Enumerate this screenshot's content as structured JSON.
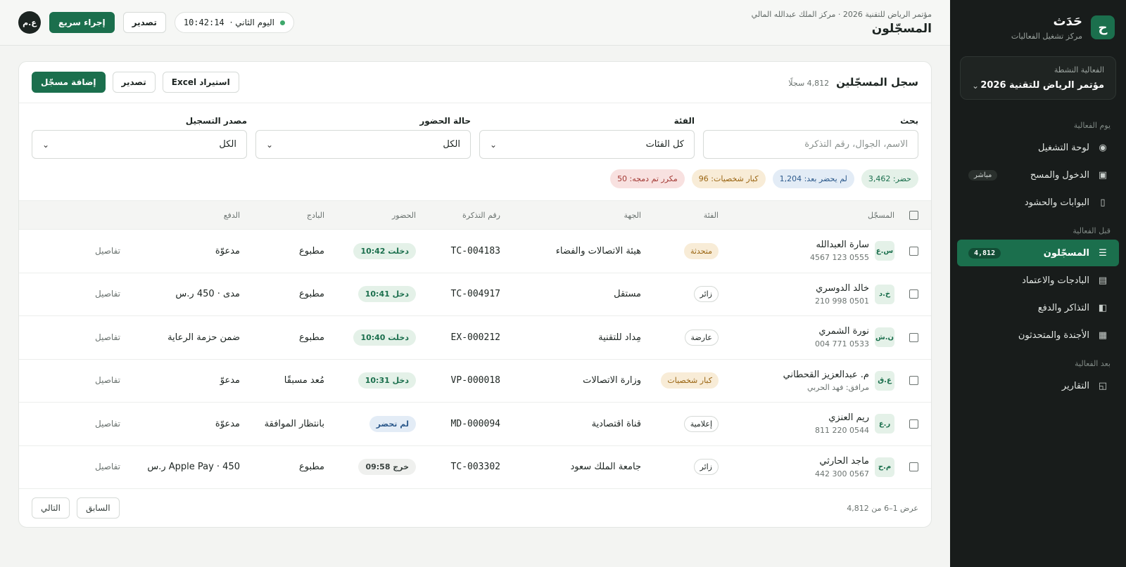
{
  "brand": {
    "logo": "ح",
    "name": "حَدَث",
    "subtitle": "مركز تشغيل الفعاليات"
  },
  "event": {
    "label": "الفعالية النشطة",
    "value": "مؤتمر الرياض للتقنية 2026"
  },
  "sidebar": {
    "sections": [
      {
        "label": "يوم الفعالية",
        "items": [
          {
            "label": "لوحة التشغيل",
            "icon": "target-icon",
            "glyph": "◉",
            "badge": ""
          },
          {
            "label": "الدخول والمسح",
            "icon": "scanner-icon",
            "glyph": "▣",
            "badge": "مباشر"
          },
          {
            "label": "البوابات والحشود",
            "icon": "gate-icon",
            "glyph": "▯",
            "badge": ""
          }
        ]
      },
      {
        "label": "قبل الفعالية",
        "items": [
          {
            "label": "المسجّلون",
            "icon": "list-icon",
            "glyph": "☰",
            "badge": "4,812",
            "active": true
          },
          {
            "label": "البادجات والاعتماد",
            "icon": "badge-icon",
            "glyph": "▤",
            "badge": ""
          },
          {
            "label": "التذاكر والدفع",
            "icon": "ticket-icon",
            "glyph": "◧",
            "badge": ""
          },
          {
            "label": "الأجندة والمتحدثون",
            "icon": "agenda-icon",
            "glyph": "▦",
            "badge": ""
          }
        ]
      },
      {
        "label": "بعد الفعالية",
        "items": [
          {
            "label": "التقارير",
            "icon": "report-icon",
            "glyph": "◱",
            "badge": ""
          }
        ]
      }
    ]
  },
  "header": {
    "subtitle": "مؤتمر الرياض للتقنية 2026 · مركز الملك عبدالله المالي",
    "title": "المسجّلون",
    "day": "اليوم الثاني ·",
    "time": "10:42:14",
    "export": "تصدير",
    "quick_action": "إجراء سريع",
    "avatar": "ع.م"
  },
  "card": {
    "title": "سجل المسجّلين",
    "count": "4,812 سجلًا",
    "import_excel": "استيراد Excel",
    "export": "تصدير",
    "add": "إضافة مسجّل"
  },
  "filters": {
    "search": {
      "label": "بحث",
      "placeholder": "الاسم، الجوال، رقم التذكرة"
    },
    "category": {
      "label": "الفئة",
      "value": "كل الفئات"
    },
    "attendance": {
      "label": "حالة الحضور",
      "value": "الكل"
    },
    "source": {
      "label": "مصدر التسجيل",
      "value": "الكل"
    }
  },
  "stats": [
    {
      "text": "حضر: 3,462",
      "color": "green"
    },
    {
      "text": "لم يحضر بعد: 1,204",
      "color": "blue"
    },
    {
      "text": "كبار شخصيات: 96",
      "color": "amber"
    },
    {
      "text": "مكرر تم دمجه: 50",
      "color": "red"
    }
  ],
  "table": {
    "columns": [
      "المسجّل",
      "الفئة",
      "الجهة",
      "رقم التذكرة",
      "الحضور",
      "البادج",
      "الدفع",
      ""
    ],
    "rows": [
      {
        "initials": "س.ع",
        "name": "سارة العبدالله",
        "phone": "0555 123 4567",
        "category": "متحدثة",
        "cat_style": "amber",
        "org": "هيئة الاتصالات والفضاء",
        "ticket": "TC-004183",
        "attendance": "دخلت 10:42",
        "att_style": "green",
        "badge": "مطبوع",
        "payment": "مدعوّة",
        "action": "تفاصيل"
      },
      {
        "initials": "خ.د",
        "name": "خالد الدوسري",
        "phone": "0501 998 210",
        "category": "زائر",
        "cat_style": "plain",
        "org": "مستقل",
        "ticket": "TC-004917",
        "attendance": "دخل 10:41",
        "att_style": "green",
        "badge": "مطبوع",
        "payment": "مدى · 450 ر.س",
        "action": "تفاصيل"
      },
      {
        "initials": "ن.ش",
        "name": "نورة الشمري",
        "phone": "0533 771 004",
        "category": "عارضة",
        "cat_style": "plain",
        "org": "مِداد للتقنية",
        "ticket": "EX-000212",
        "attendance": "دخلت 10:40",
        "att_style": "green",
        "badge": "مطبوع",
        "payment": "ضمن حزمة الرعاية",
        "action": "تفاصيل"
      },
      {
        "initials": "ع.ق",
        "name": "م. عبدالعزيز القحطاني",
        "phone": "مرافق: فهد الحربي",
        "category": "كبار شخصيات",
        "cat_style": "amber",
        "org": "وزارة الاتصالات",
        "ticket": "VP-000018",
        "attendance": "دخل 10:31",
        "att_style": "green",
        "badge": "مُعد مسبقًا",
        "payment": "مدعوّ",
        "action": "تفاصيل"
      },
      {
        "initials": "ر.ع",
        "name": "ريم العنزي",
        "phone": "0544 220 811",
        "category": "إعلامية",
        "cat_style": "plain",
        "org": "قناة اقتصادية",
        "ticket": "MD-000094",
        "attendance": "لم تحضر",
        "att_style": "blue",
        "badge": "بانتظار الموافقة",
        "payment": "مدعوّة",
        "action": "تفاصيل"
      },
      {
        "initials": "م.ح",
        "name": "ماجد الحارثي",
        "phone": "0567 300 442",
        "category": "زائر",
        "cat_style": "plain",
        "org": "جامعة الملك سعود",
        "ticket": "TC-003302",
        "attendance": "خرج 09:58",
        "att_style": "gray",
        "badge": "مطبوع",
        "payment": "Apple Pay · 450 ر.س",
        "action": "تفاصيل"
      }
    ]
  },
  "footer": {
    "info": "عرض 1–6 من 4,812",
    "prev": "السابق",
    "next": "التالي"
  },
  "colors": {
    "accent": "#1b6f4d",
    "sidebar": "#181c1b"
  }
}
